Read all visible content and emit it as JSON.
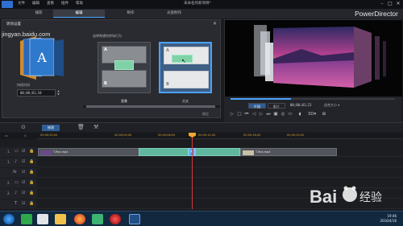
{
  "titlebar": {
    "menus": [
      "文件",
      "编辑",
      "查看",
      "插件",
      "帮助"
    ],
    "document_title": "未命名的新项目*"
  },
  "modes": {
    "tabs": [
      "捕获",
      "编辑",
      "制作",
      "光盘制作"
    ],
    "active_index": 1,
    "brand": "PowerDirector"
  },
  "transition_panel": {
    "title": "转场设置",
    "duration_label": "持续时间",
    "duration_value": "00;00;01;10",
    "choose_label": "选择希望的转场行为",
    "options": [
      {
        "name": "重叠",
        "a": "A",
        "b": "B",
        "selected": false
      },
      {
        "name": "交叉",
        "a": "A",
        "b": "B",
        "selected": true
      }
    ],
    "ok_label": "确定",
    "thumb_letter": "A"
  },
  "preview": {
    "tabs": [
      "片段",
      "影片"
    ],
    "active_tab": 0,
    "timecode": "00;00;01;21",
    "fit_label": "适合大小",
    "seek_progress": 0.37,
    "controls": [
      "play-icon",
      "stop-icon",
      "prev-frame-icon",
      "next-frame-icon",
      "fast-forward-icon",
      "snapshot-icon",
      "volume-icon",
      "fullscreen-icon"
    ],
    "mode_3d": "3D"
  },
  "toolbar": {
    "main_button": "修改"
  },
  "timeline": {
    "ticks": [
      "00;00;00;00",
      "00;00;04;00",
      "00;00;08;00",
      "00;00;12;00",
      "00;00;16;00",
      "00;00;20;00",
      "00;00;24;00",
      "00;00;28;00",
      "00;00;32;00",
      "00;00;36;00"
    ],
    "tracks": [
      {
        "num": "1.",
        "clips": [
          "T-Rex.mp4",
          "T-Rex.mp4"
        ]
      },
      {
        "num": "1.",
        "clips": []
      },
      {
        "num": "",
        "clips": []
      },
      {
        "num": "2.",
        "clips": []
      },
      {
        "num": "2.",
        "clips": []
      },
      {
        "num": "",
        "clips": []
      }
    ]
  },
  "taskbar": {
    "time": "19:46",
    "date": "2016/4/16"
  },
  "watermark": {
    "text": "jingyan.baidu.com"
  }
}
